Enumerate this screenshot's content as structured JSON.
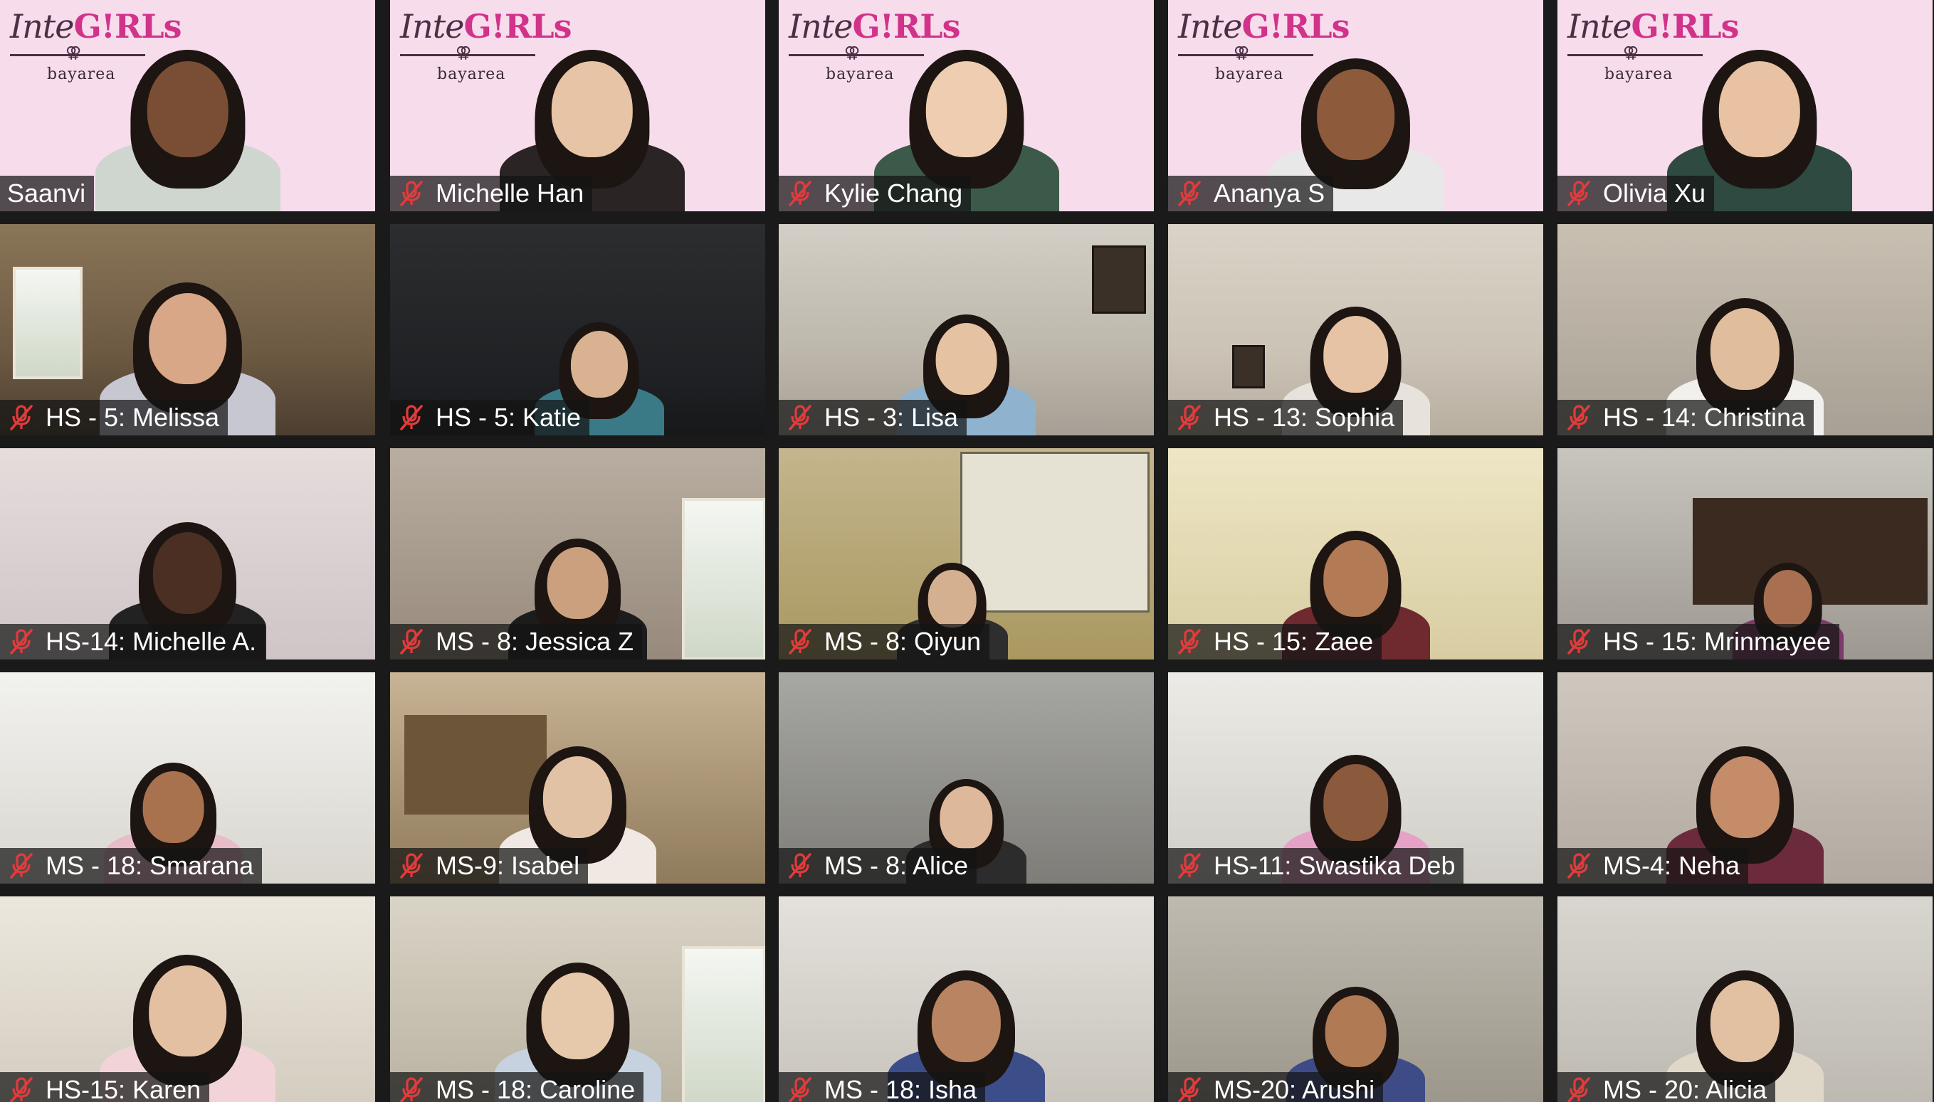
{
  "logo": {
    "name_part1": "Inte",
    "name_part2": "G!RLs",
    "symbol": "⚢",
    "sub": "bayarea"
  },
  "participants": [
    {
      "name": "Saanvi",
      "muted": false,
      "active": true
    },
    {
      "name": "Michelle Han",
      "muted": true
    },
    {
      "name": "Kylie Chang",
      "muted": true
    },
    {
      "name": "Ananya S",
      "muted": true
    },
    {
      "name": "Olivia Xu",
      "muted": true
    },
    {
      "name": "HS - 5: Melissa",
      "muted": true
    },
    {
      "name": "HS - 5: Katie",
      "muted": true
    },
    {
      "name": "HS - 3: Lisa",
      "muted": true
    },
    {
      "name": "HS - 13: Sophia",
      "muted": true
    },
    {
      "name": "HS - 14: Christina",
      "muted": true
    },
    {
      "name": "HS-14: Michelle A.",
      "muted": true
    },
    {
      "name": "MS - 8: Jessica Z",
      "muted": true
    },
    {
      "name": "MS - 8: Qiyun",
      "muted": true
    },
    {
      "name": "HS - 15: Zaee",
      "muted": true
    },
    {
      "name": "HS - 15: Mrinmayee",
      "muted": true
    },
    {
      "name": "MS - 18: Smarana",
      "muted": true
    },
    {
      "name": "MS-9: Isabel",
      "muted": true
    },
    {
      "name": "MS - 8: Alice",
      "muted": true
    },
    {
      "name": "HS-11: Swastika Deb",
      "muted": true
    },
    {
      "name": "MS-4: Neha",
      "muted": true
    },
    {
      "name": "HS-15: Karen",
      "muted": true
    },
    {
      "name": "MS - 18: Caroline",
      "muted": true
    },
    {
      "name": "MS - 18: Isha",
      "muted": true
    },
    {
      "name": "MS-20: Arushi",
      "muted": true
    },
    {
      "name": "MS - 20: Alicia",
      "muted": true
    }
  ],
  "colors": {
    "active_border": "#e9f34a",
    "mute_icon": "#e23b3b",
    "label_bg": "rgba(20,20,20,0.72)",
    "logo_pink": "#d1338a",
    "tile_pink": "#f7dcec"
  }
}
